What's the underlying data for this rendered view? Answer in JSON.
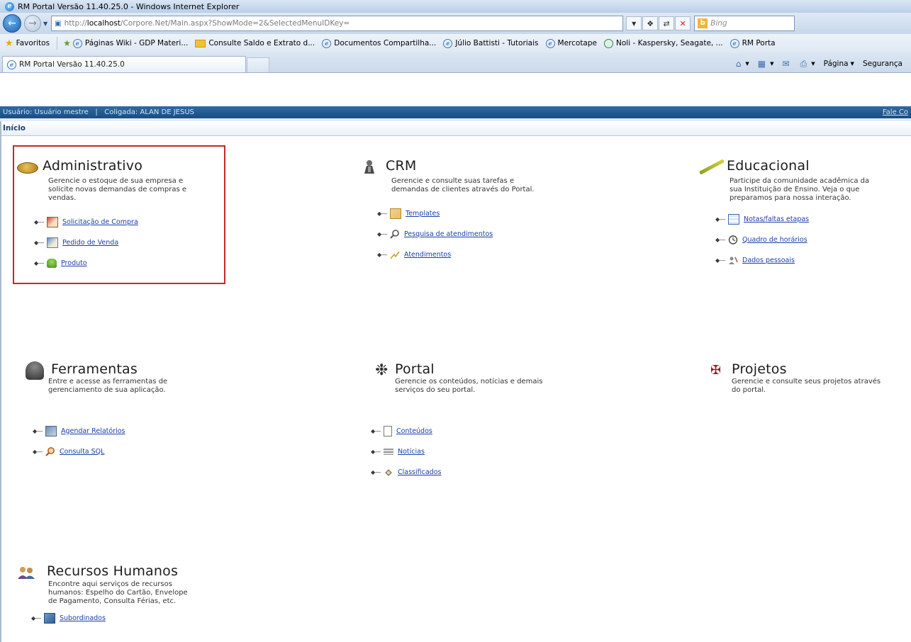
{
  "browser": {
    "window_title": "RM Portal Versão 11.40.25.0 - Windows Internet Explorer",
    "address": {
      "prefix": "http://",
      "host": "localhost",
      "path": "/Corpore.Net/Main.aspx?ShowMode=2&SelectedMenuIDKey="
    },
    "search_placeholder": "Bing",
    "favorites": [
      "Favoritos",
      "Páginas Wiki - GDP Materi...",
      "Consulte Saldo e Extrato d...",
      "Documentos Compartilha...",
      "Júlio Battisti - Tutoriais",
      "Mercotape",
      "Noli - Kaspersky, Seagate, ...",
      "RM Porta"
    ],
    "tab_title": "RM Portal Versão 11.40.25.0",
    "commands": {
      "page": "Página",
      "security": "Segurança"
    }
  },
  "portal": {
    "user_bar": "Usuário: Usuário mestre   |   Coligada: ALAN DE JESUS",
    "user_bar_link": "Fale Co",
    "breadcrumb": "Início"
  },
  "modules": {
    "administrativo": {
      "title": "Administrativo",
      "description": "Gerencie o estoque de sua empresa e solicite novas demandas de compras e vendas.",
      "links": [
        "Solicitação de Compra",
        "Pedido de Venda",
        "Produto"
      ]
    },
    "crm": {
      "title": "CRM",
      "description": "Gerencie e consulte suas tarefas e demandas de clientes através do Portal.",
      "links": [
        "Templates",
        "Pesquisa de atendimentos",
        "Atendimentos"
      ]
    },
    "educacional": {
      "title": "Educacional",
      "description": "Participe da comunidade acadêmica da sua Instituição de Ensino. Veja o que preparamos para nossa interação.",
      "links": [
        "Notas/faltas etapas",
        "Quadro de horários",
        "Dados pessoais"
      ]
    },
    "ferramentas": {
      "title": "Ferramentas",
      "description": "Entre e acesse as ferramentas de gerenciamento de sua aplicação.",
      "links": [
        "Agendar Relatórios",
        "Consulta SQL"
      ]
    },
    "portal": {
      "title": "Portal",
      "description": "Gerencie os conteúdos, notícias e demais serviços do seu portal.",
      "links": [
        "Conteúdos",
        "Notícias",
        "Classificados"
      ]
    },
    "projetos": {
      "title": "Projetos",
      "description": "Gerencie e consulte seus projetos através do portal.",
      "links": []
    },
    "rh": {
      "title": "Recursos Humanos",
      "description": "Encontre aqui serviços de recursos humanos: Espelho do Cartão, Envelope de Pagamento, Consulta Férias, etc.",
      "links": [
        "Subordinados"
      ]
    }
  },
  "colors": {
    "highlight_border": "#c62828",
    "link": "#1a3fa6",
    "user_bar": "#1a4d82"
  }
}
